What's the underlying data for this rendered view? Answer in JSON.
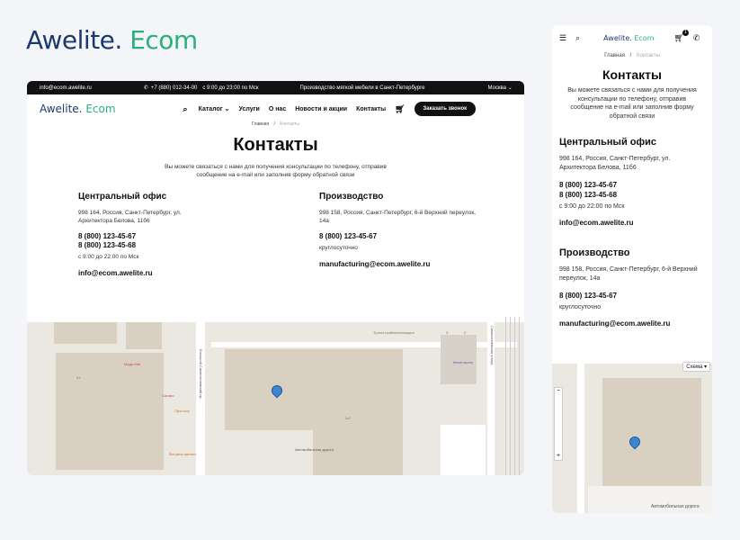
{
  "brand": {
    "part1": "Awelite.",
    "part2": "Ecom"
  },
  "desktop": {
    "topbar": {
      "email": "info@ecom.awelite.ru",
      "phone": "+7 (880) 012-34-00",
      "hours": "с 9:00 до 23:00 по Мск",
      "promo": "Производство мягкой мебели в Санкт-Петербурге",
      "city": "Москва"
    },
    "nav": [
      "Каталог",
      "Услуги",
      "О нас",
      "Новости и акции",
      "Контакты"
    ],
    "call_button": "Заказать звонок",
    "breadcrumb": {
      "home": "Главная",
      "sep": "/",
      "current": "Контакты"
    },
    "title": "Контакты",
    "lead": "Вы можете связаться с нами для получения консультации по телефону, отправив сообщение на e-mail или заполнив форму обратной связи"
  },
  "office": {
    "title": "Центральный офис",
    "address": "998 164, Россия, Санкт-Петербург, ул. Архитектора Белова, 11б6",
    "phone1": "8 (800) 123-45-67",
    "phone2": "8 (800) 123-45-68",
    "hours": "с 9:00 до 22:00 по Мск",
    "email": "info@ecom.awelite.ru"
  },
  "production": {
    "title": "Производство",
    "address": "998 158, Россия, Санкт-Петербург, 6-й Верхний переулок, 14а",
    "phone": "8 (800) 123-45-67",
    "hours": "круглосуточно",
    "email": "manufacturing@ecom.awelite.ru"
  },
  "map": {
    "labels": {
      "street1": "Большой Сампсониевский пр.",
      "street2": "Сампсониевская улица",
      "org1": "Трансстроймеханизация",
      "org2": "Магистраль",
      "poi1": "Мадо-Кин",
      "poi2": "Сакэро",
      "poi3": "Простоф",
      "poi4": "Автомобильная дорога",
      "poi5": "Витрина фитнес",
      "num1": "23",
      "num2": "3",
      "num3": "2",
      "num4": "2к7"
    },
    "scheme": "Схема"
  },
  "mobile": {
    "cart_count": "1",
    "lead": "Вы можете связаться с нами для получения консультации по телефону, отправив сообщение на e-mail или заполнив форму обратной связи"
  },
  "colors": {
    "brand_dark": "#1a3a6b",
    "brand_green": "#2ab07a",
    "pin": "#3d86d0"
  }
}
